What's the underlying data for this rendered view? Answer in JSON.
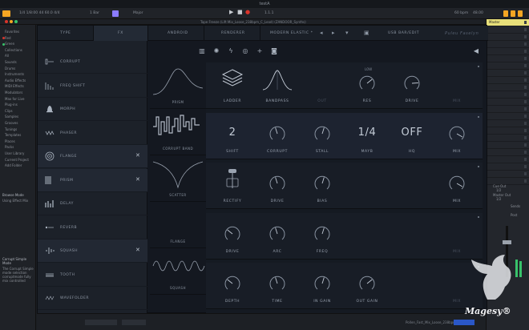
{
  "window": {
    "title": "testA"
  },
  "transport": {
    "left_text": "1/4  1/8:00 44  60.0  4/4",
    "tempo": "1 Bar",
    "mode": "Major",
    "position": "1.1.1",
    "right_text": "60 bpm",
    "cpu": "48.00"
  },
  "subbar": {
    "text": "Tape Freeze (Lift Mix_Loose_238bpm_C_Lead)  (ZANDOOR_Synths)"
  },
  "browser": {
    "items": [
      "Favorites",
      "Red",
      "Green",
      "Collections",
      "All",
      "Sounds",
      "Drums",
      "Instruments",
      "Audio Effects",
      "MIDI Effects",
      "Modulators",
      "Max for Live",
      "Plug-ins",
      "Clips",
      "Samples",
      "Grooves",
      "Tunings",
      "Templates",
      "Places",
      "Packs",
      "User Library",
      "Current Project",
      "Add Folder"
    ],
    "info_title": "Browse Mode",
    "info_text": "Using Effect Mix",
    "bottom_title": "Corrupt Simple Mode",
    "bottom_text": "The Corrupt Simple mode selection corruptmode fully mix controlled"
  },
  "plugin": {
    "tabs": [
      "TYPE",
      "FX",
      "ANDROID",
      "RENDERER"
    ],
    "preset_name": "MODERN ELASTIC *",
    "nav_prev": "◂",
    "nav_next": "▸",
    "save_label": "SAVE",
    "io_label": "USB BAR/EDIT",
    "brand": "Puleu Faselyn",
    "fx_list": [
      {
        "label": "CORRUPT",
        "icon": "corrupt-icon",
        "selected": false,
        "removable": false
      },
      {
        "label": "FREQ SHIFT",
        "icon": "freq-shift-icon",
        "selected": false,
        "removable": false
      },
      {
        "label": "MORPH",
        "icon": "bell-icon",
        "selected": false,
        "removable": false
      },
      {
        "label": "PHASER",
        "icon": "phaser-icon",
        "selected": false,
        "removable": false
      },
      {
        "label": "FLANGE",
        "icon": "flange-icon",
        "selected": true,
        "removable": true
      },
      {
        "label": "PRISM",
        "icon": "prism-icon",
        "selected": true,
        "removable": true
      },
      {
        "label": "DELAY",
        "icon": "delay-icon",
        "selected": false,
        "removable": false
      },
      {
        "label": "REVERB",
        "icon": "reverb-icon",
        "selected": false,
        "removable": false
      },
      {
        "label": "SQUASH",
        "icon": "squash-icon",
        "selected": true,
        "removable": true
      },
      {
        "label": "TOOTH",
        "icon": "tooth-icon",
        "selected": false,
        "removable": false
      },
      {
        "label": "WAVEFOLDER",
        "icon": "wavefolder-icon",
        "selected": false,
        "removable": false
      }
    ],
    "close_glyph": "✕",
    "toolbar_icons": [
      "waveform-icon",
      "globe-icon",
      "bolt-icon",
      "target-icon",
      "plus-icon",
      "camera-icon"
    ],
    "speaker_icon": "speaker-icon",
    "thumbnails": [
      "PRISM",
      "CORRUPT BAND",
      "SCATTER",
      "FLANGE",
      "SQUASH"
    ],
    "panels": [
      {
        "labels": [
          "LADDER",
          "BANDPASS",
          "OUT",
          "RES",
          "DRIVE",
          "MIX"
        ],
        "dim": [
          false,
          false,
          true,
          false,
          false,
          true
        ],
        "corner": "LOW"
      },
      {
        "labels": [
          "SHIFT",
          "CORRUPT",
          "STALL",
          "MAYB",
          "HQ",
          "MIX"
        ],
        "values": [
          "2",
          "",
          "",
          "1/4",
          "OFF",
          ""
        ]
      },
      {
        "labels": [
          "RECTIFY",
          "DRIVE",
          "BIAS",
          "",
          "",
          "MIX"
        ]
      },
      {
        "labels": [
          "DRIVE",
          "ARC",
          "FREQ",
          "",
          "",
          "MIX"
        ],
        "dim": [
          false,
          false,
          false,
          false,
          false,
          true
        ]
      },
      {
        "labels": [
          "DEPTH",
          "TIME",
          "IN GAIN",
          "OUT GAIN",
          "",
          "MIX"
        ],
        "dim": [
          false,
          false,
          false,
          false,
          false,
          true
        ]
      }
    ]
  },
  "right_strip": {
    "tracks": [
      "Master",
      "",
      "",
      "",
      "",
      "",
      "",
      "",
      "",
      "",
      "",
      "",
      "",
      "",
      "",
      "",
      "",
      "",
      "",
      "",
      "",
      "",
      ""
    ],
    "cue_out": "Cue Out",
    "cue_val": "1/2",
    "master_out": "Master Out",
    "master_val": "1/2",
    "sends": "Sends",
    "post": "Post"
  },
  "bottom": {
    "clip_text": "Pollen_Fast_Mix_Loose_238bpm_C_..."
  },
  "watermark": {
    "brand": "Magesy®"
  },
  "colors": {
    "accent": "#f5a623",
    "record": "#d9342b",
    "selected": "#8b7cff",
    "green": "#38c26a"
  }
}
